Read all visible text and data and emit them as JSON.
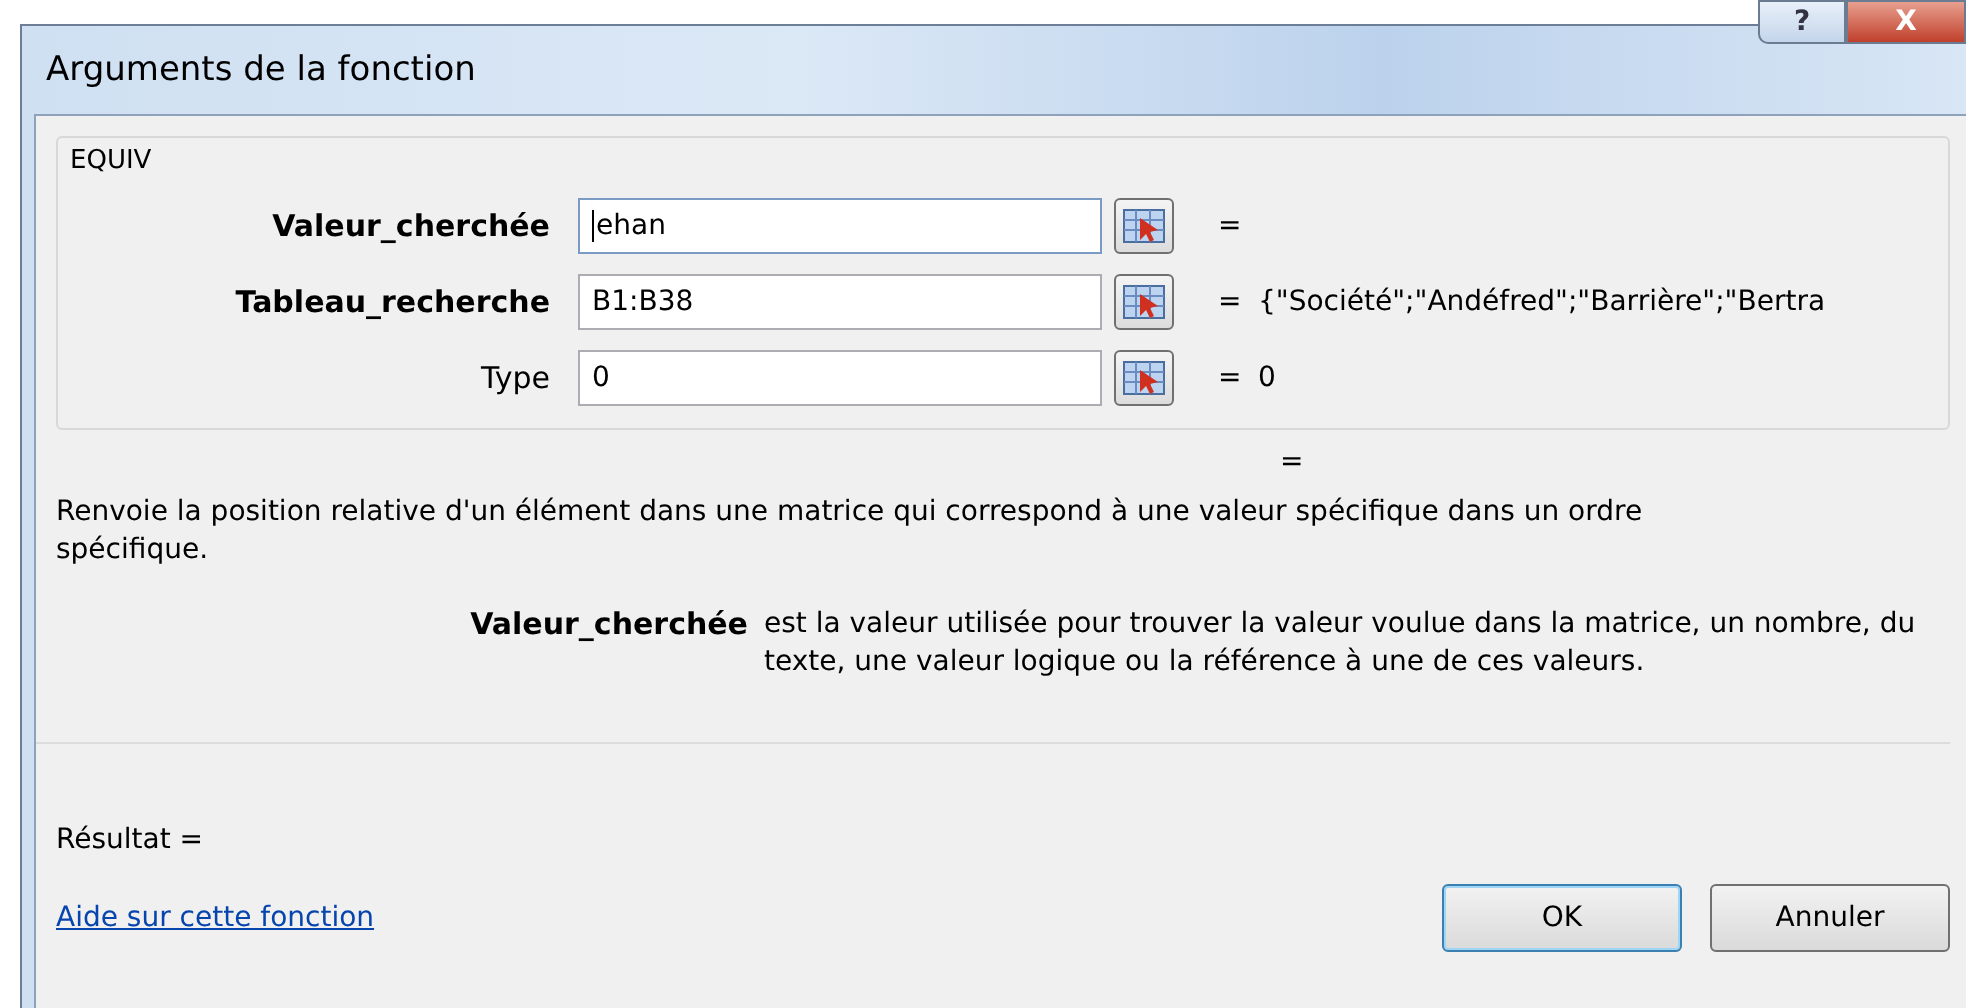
{
  "window": {
    "title": "Arguments de la fonction",
    "help_button": "?",
    "close_button": "X"
  },
  "function_name": "EQUIV",
  "arguments": [
    {
      "label": "Valeur_cherchée",
      "bold": true,
      "value": "ehan",
      "focused": true,
      "equals": "="
    },
    {
      "label": "Tableau_recherche",
      "bold": true,
      "value": "B1:B38",
      "focused": false,
      "equals": "=",
      "result": "{\"Société\";\"Andéfred\";\"Barrière\";\"Bertra"
    },
    {
      "label": "Type",
      "bold": false,
      "value": "0",
      "focused": false,
      "equals": "=",
      "result": "0"
    }
  ],
  "formula_equals": "=",
  "description": "Renvoie la position relative d'un élément dans une matrice qui correspond à une valeur spécifique dans un ordre spécifique.",
  "argument_help": {
    "name": "Valeur_cherchée",
    "text": "est la valeur utilisée pour trouver la valeur voulue dans la matrice, un nombre, du texte, une valeur logique ou la référence à une de ces valeurs."
  },
  "result_label": "Résultat =",
  "help_link": "Aide sur cette fonction",
  "buttons": [
    {
      "label": "OK",
      "default": true
    },
    {
      "label": "Annuler",
      "default": false
    }
  ]
}
